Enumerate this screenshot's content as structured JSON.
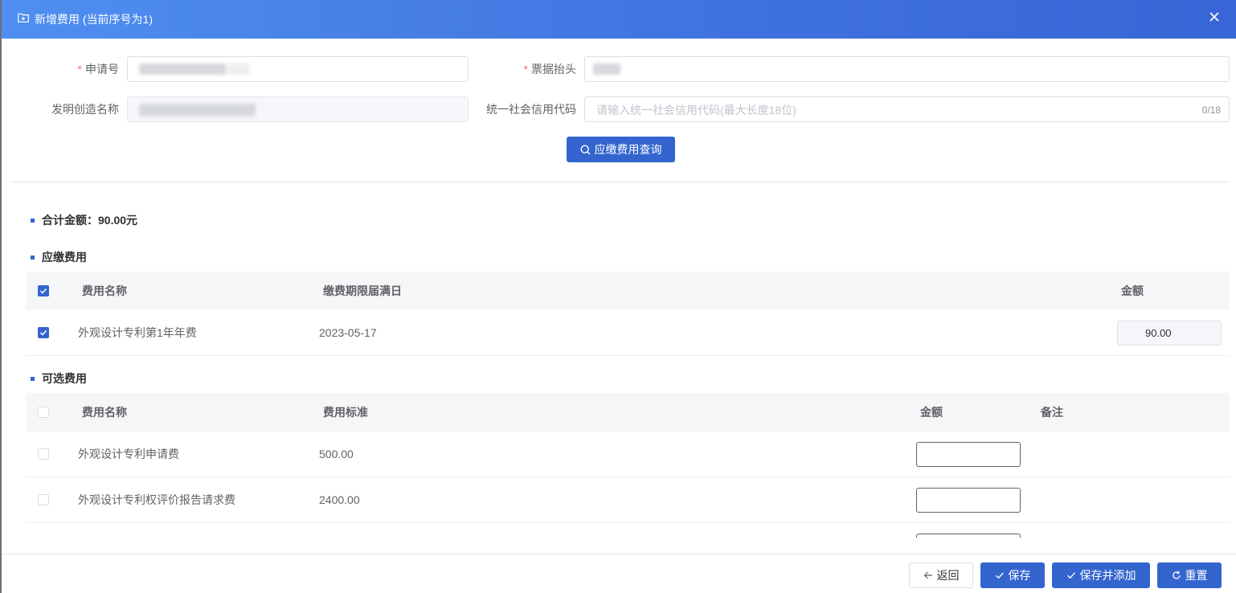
{
  "dialog": {
    "title": "新增费用 (当前序号为1)",
    "title_icon": "folder-add-icon",
    "close_icon": "close-icon"
  },
  "form": {
    "application_no": {
      "label": "申请号",
      "required": "*"
    },
    "invoice_title": {
      "label": "票据抬头",
      "required": "*"
    },
    "invention_name": {
      "label": "发明创造名称"
    },
    "credit_code": {
      "label": "统一社会信用代码",
      "placeholder": "请输入统一社会信用代码(最大长度18位)",
      "counter": "0/18"
    },
    "query_button": "应缴费用查询"
  },
  "summary": {
    "total_label": "合计金额：90.00元"
  },
  "payable": {
    "title": "应缴费用",
    "columns": [
      "费用名称",
      "缴费期限届满日",
      "金额"
    ],
    "rows": [
      {
        "name": "外观设计专利第1年年费",
        "deadline": "2023-05-17",
        "amount": "90.00",
        "checked": true
      }
    ]
  },
  "optional": {
    "title": "可选费用",
    "columns": [
      "费用名称",
      "费用标准",
      "金额",
      "备注"
    ],
    "rows": [
      {
        "name": "外观设计专利申请费",
        "standard": "500.00",
        "checked": false
      },
      {
        "name": "外观设计专利权评价报告请求费",
        "standard": "2400.00",
        "checked": false
      }
    ]
  },
  "footer": {
    "back": "返回",
    "save": "保存",
    "save_add": "保存并添加",
    "reset": "重置"
  },
  "colors": {
    "primary": "#3465cf",
    "header_gradient_start": "#4f8ff0",
    "header_gradient_end": "#3866d6",
    "required": "#f56c6c"
  }
}
